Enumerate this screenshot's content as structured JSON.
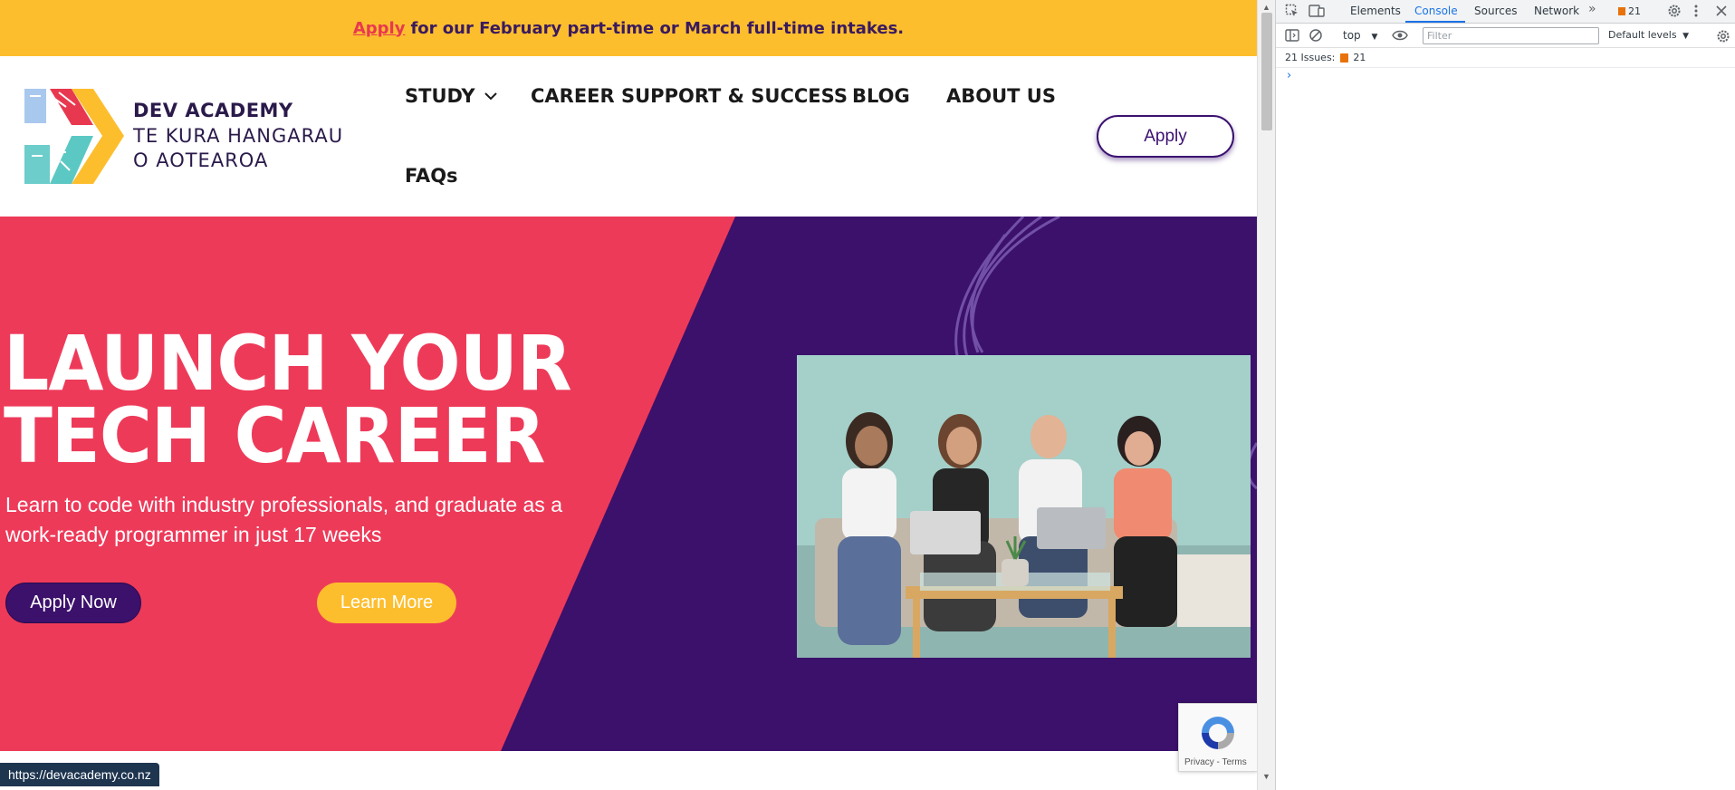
{
  "promo_bar": {
    "link_text": "Apply",
    "message": "for our February part-time or March full-time intakes."
  },
  "brand": {
    "line1": "DEV ACADEMY",
    "line2": "TE KURA HANGARAU",
    "line3": "O AOTEAROA"
  },
  "nav": {
    "study": "STUDY",
    "career": "CAREER SUPPORT & SUCCESS",
    "blog": "BLOG",
    "about": "ABOUT US",
    "faqs": "FAQs",
    "apply": "Apply"
  },
  "hero": {
    "title_line1": "LAUNCH YOUR",
    "title_line2": "TECH CAREER",
    "subtitle": "Learn to code with industry professionals, and graduate as a work-ready programmer in just 17 weeks",
    "apply_now": "Apply Now",
    "learn_more": "Learn More"
  },
  "recaptcha": {
    "links": "Privacy - Terms"
  },
  "status_bar": {
    "url": "https://devacademy.co.nz"
  },
  "devtools": {
    "tabs": [
      "Elements",
      "Console",
      "Sources",
      "Network"
    ],
    "active_tab": "Console",
    "issues_badge_count": "21",
    "context": "top",
    "filter_placeholder": "Filter",
    "levels": "Default levels",
    "issues_label": "21 Issues:",
    "issues_count": "21",
    "prompt_symbol": "›"
  },
  "colors": {
    "promo_yellow": "#fdbe2e",
    "brand_pink": "#e8384f",
    "brand_purple": "#3b116b",
    "devtools_blue": "#1a73e8",
    "issue_orange": "#e8710a"
  },
  "icons": [
    "chevron-down-icon",
    "inspect-element-icon",
    "device-toolbar-icon",
    "more-tabs-icon",
    "settings-gear-icon",
    "kebab-menu-icon",
    "close-icon",
    "sidebar-toggle-icon",
    "clear-console-icon",
    "eye-icon",
    "recaptcha-icon"
  ]
}
